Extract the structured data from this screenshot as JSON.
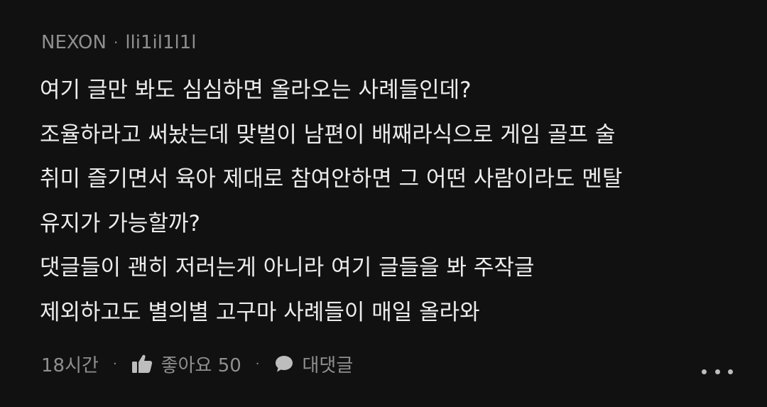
{
  "comment": {
    "source": "NEXON",
    "separator": "·",
    "username": "lli1il1l1l",
    "lines": [
      "여기 글만 봐도 심심하면 올라오는 사례들인데?",
      "조율하라고 써놨는데 맞벌이 남편이 배째라식으로 게임 골프 술",
      "취미 즐기면서 육아 제대로 참여안하면 그 어떤 사람이라도 멘탈",
      "유지가 가능할까?",
      "댓글들이 괜히 저러는게 아니라 여기 글들을 봐 주작글",
      "제외하고도 별의별 고구마 사례들이 매일 올라와"
    ],
    "timestamp": "18시간",
    "like_label": "좋아요 50",
    "reply_label": "대댓글",
    "icons": {
      "like": "thumbs-up-icon",
      "reply": "speech-bubble-icon",
      "more": "more-dots-icon"
    },
    "colors": {
      "background": "#111111",
      "text": "#ececec",
      "muted": "#8f8f8f"
    }
  }
}
